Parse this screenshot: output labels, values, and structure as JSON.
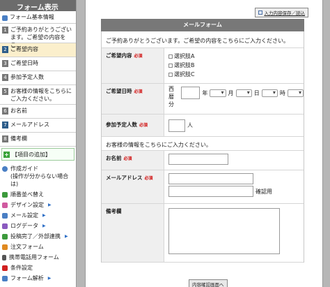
{
  "sidebar": {
    "header": "フォーム表示",
    "basic": "フォーム基本情報",
    "items": [
      {
        "num": "1",
        "label": "ご予約ありがとうございます。ご希望の内容をこ..."
      },
      {
        "num": "2",
        "label": "ご希望内容"
      },
      {
        "num": "3",
        "label": "ご希望日時"
      },
      {
        "num": "4",
        "label": "参加予定人数"
      },
      {
        "num": "5",
        "label": "お客様の情報をこちらにご入力ください。"
      },
      {
        "num": "6",
        "label": "お名前"
      },
      {
        "num": "7",
        "label": "メールアドレス"
      },
      {
        "num": "8",
        "label": "備考欄"
      }
    ],
    "add_item": "【項目の追加】",
    "links": [
      {
        "label": "作成ガイド",
        "sub": "(操作が分からない場合は)",
        "icon": "help-icon",
        "color": "#4a7fc4"
      },
      {
        "label": "順番並べ替え",
        "icon": "sort-icon",
        "color": "#3c9a3c"
      },
      {
        "label": "デザイン設定",
        "icon": "design-icon",
        "color": "#d05aa0",
        "arrow": "▶"
      },
      {
        "label": "メール設定",
        "icon": "mail-icon",
        "color": "#4a7fc4",
        "arrow": "▶"
      },
      {
        "label": "ログデータ",
        "icon": "log-icon",
        "color": "#8a5ac0",
        "arrow": "▶"
      },
      {
        "label": "投稿完了／外部連携",
        "icon": "complete-icon",
        "color": "#3c9a3c",
        "arrow": "▶"
      },
      {
        "label": "注文フォーム",
        "icon": "order-icon",
        "color": "#e08a20"
      },
      {
        "label": "携帯電話用フォーム",
        "icon": "mobile-icon",
        "color": "#555555"
      },
      {
        "label": "条件設定",
        "icon": "condition-icon",
        "color": "#d02020"
      },
      {
        "label": "フォーム解析",
        "icon": "analysis-icon",
        "color": "#4a7fc4",
        "arrow": "▶"
      }
    ]
  },
  "main": {
    "save_button": "入力内容保存／読込",
    "form_title": "メールフォーム",
    "intro": "ご予約ありがとうございます。ご希望の内容をこちらにご入力ください。",
    "required": "必須",
    "content_label": "ご希望内容",
    "options": [
      "選択肢A",
      "選択肢B",
      "選択肢C"
    ],
    "date_label": "ご希望日時",
    "date_era": "西暦",
    "date_year": "年",
    "date_month": "月",
    "date_day": "日",
    "date_hour": "時",
    "date_minute": "分",
    "people_label": "参加予定人数",
    "people_unit": "人",
    "customer_text": "お客様の情報をこちらにご入力ください。",
    "name_label": "お名前",
    "email_label": "メールアドレス",
    "confirm_label": "確認用",
    "notes_label": "備考欄",
    "confirm_button": "内容確認画面へ"
  }
}
